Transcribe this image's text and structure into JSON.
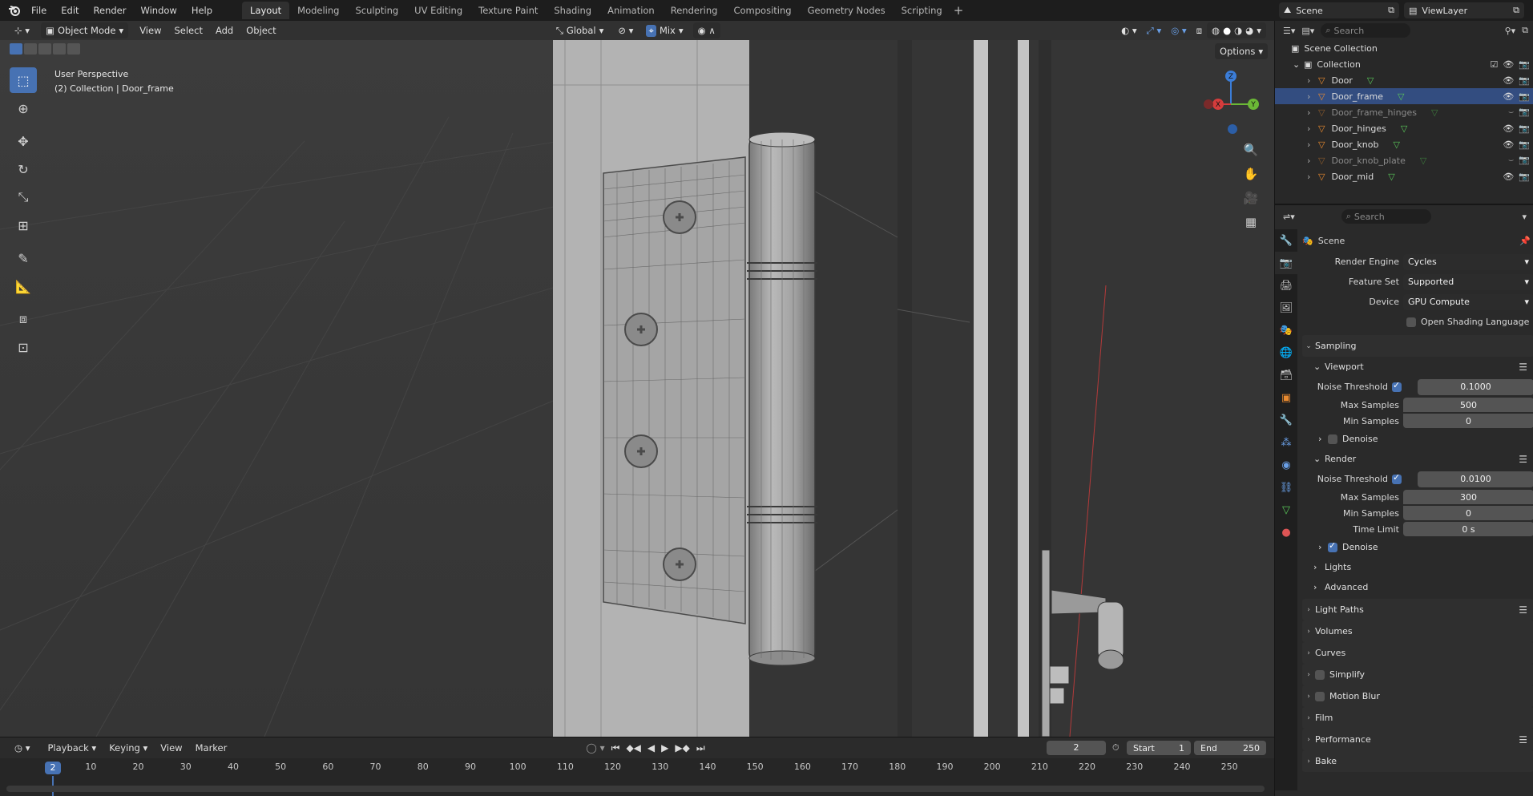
{
  "topbar": {
    "menus": [
      "File",
      "Edit",
      "Render",
      "Window",
      "Help"
    ],
    "workspaces": [
      "Layout",
      "Modeling",
      "Sculpting",
      "UV Editing",
      "Texture Paint",
      "Shading",
      "Animation",
      "Rendering",
      "Compositing",
      "Geometry Nodes",
      "Scripting"
    ],
    "active_workspace": "Layout",
    "scene_name": "Scene",
    "view_layer": "ViewLayer"
  },
  "viewport": {
    "mode": "Object Mode",
    "menus": [
      "View",
      "Select",
      "Add",
      "Object"
    ],
    "transform_orientation": "Global",
    "snap_mode": "Mix",
    "options_label": "Options",
    "info_line1": "User Perspective",
    "info_line2": "(2) Collection | Door_frame",
    "gizmo": {
      "x": "X",
      "y": "Y",
      "z": "Z"
    }
  },
  "outliner": {
    "search_placeholder": "Search",
    "scene_collection": "Scene Collection",
    "collection": "Collection",
    "items": [
      {
        "name": "Door",
        "selected": false,
        "dim": false
      },
      {
        "name": "Door_frame",
        "selected": true,
        "dim": false
      },
      {
        "name": "Door_frame_hinges",
        "selected": false,
        "dim": true
      },
      {
        "name": "Door_hinges",
        "selected": false,
        "dim": false
      },
      {
        "name": "Door_knob",
        "selected": false,
        "dim": false
      },
      {
        "name": "Door_knob_plate",
        "selected": false,
        "dim": true
      },
      {
        "name": "Door_mid",
        "selected": false,
        "dim": false
      }
    ]
  },
  "properties": {
    "search_placeholder": "Search",
    "context": "Scene",
    "render_engine_label": "Render Engine",
    "render_engine": "Cycles",
    "feature_set_label": "Feature Set",
    "feature_set": "Supported",
    "device_label": "Device",
    "device": "GPU Compute",
    "osl_label": "Open Shading Language",
    "sampling": "Sampling",
    "viewport_label": "Viewport",
    "render_label": "Render",
    "noise_threshold_label": "Noise Threshold",
    "max_samples_label": "Max Samples",
    "min_samples_label": "Min Samples",
    "time_limit_label": "Time Limit",
    "denoise_label": "Denoise",
    "viewport_noise": "0.1000",
    "viewport_max": "500",
    "viewport_min": "0",
    "render_noise": "0.0100",
    "render_max": "300",
    "render_min": "0",
    "render_time_limit": "0 s",
    "sub_panels": [
      "Lights",
      "Advanced"
    ],
    "panels": [
      "Light Paths",
      "Volumes",
      "Curves",
      "Simplify",
      "Motion Blur",
      "Film",
      "Performance",
      "Bake"
    ]
  },
  "timeline": {
    "menus": [
      "Playback",
      "Keying",
      "View",
      "Marker"
    ],
    "current_frame": "2",
    "start_label": "Start",
    "start": "1",
    "end_label": "End",
    "end": "250",
    "ticks": [
      "10",
      "20",
      "30",
      "40",
      "50",
      "60",
      "70",
      "80",
      "90",
      "100",
      "110",
      "120",
      "130",
      "140",
      "150",
      "160",
      "170",
      "180",
      "190",
      "200",
      "210",
      "220",
      "230",
      "240",
      "250"
    ]
  }
}
